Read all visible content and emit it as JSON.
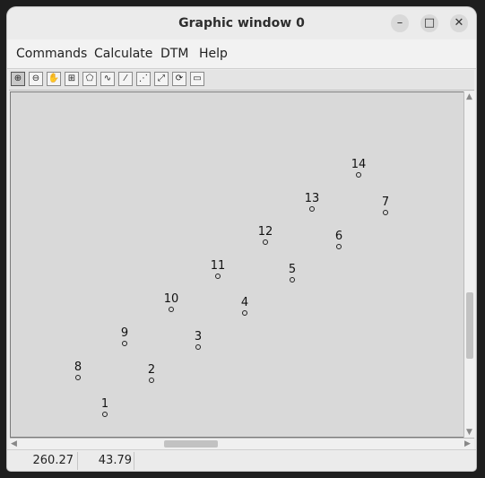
{
  "window": {
    "title": "Graphic window 0",
    "controls": {
      "minimize": "–",
      "maximize": "□",
      "close": "✕"
    }
  },
  "menubar": {
    "items": [
      "Commands",
      "Calculate",
      "DTM",
      "Help"
    ]
  },
  "toolbar": {
    "tools": [
      {
        "name": "zoom-in-tool",
        "glyph": "⊕"
      },
      {
        "name": "zoom-out-tool",
        "glyph": "⊖"
      },
      {
        "name": "pan-hand-tool",
        "glyph": "✋"
      },
      {
        "name": "measure-tool",
        "glyph": "⊞"
      },
      {
        "name": "polygon-tool",
        "glyph": "⬠"
      },
      {
        "name": "contour-tool",
        "glyph": "∿"
      },
      {
        "name": "draw-line-tool",
        "glyph": "⁄"
      },
      {
        "name": "select-point-tool",
        "glyph": "⋰"
      },
      {
        "name": "fit-extents-tool",
        "glyph": "⤢"
      },
      {
        "name": "refresh-tool",
        "glyph": "⟳"
      },
      {
        "name": "select-rect-tool",
        "glyph": "▭"
      }
    ]
  },
  "points": [
    {
      "label": "1"
    },
    {
      "label": "2"
    },
    {
      "label": "3"
    },
    {
      "label": "4"
    },
    {
      "label": "5"
    },
    {
      "label": "6"
    },
    {
      "label": "7"
    },
    {
      "label": "8"
    },
    {
      "label": "9"
    },
    {
      "label": "10"
    },
    {
      "label": "11"
    },
    {
      "label": "12"
    },
    {
      "label": "13"
    },
    {
      "label": "14"
    }
  ],
  "status": {
    "x": "260.27",
    "y": "43.79"
  },
  "scrollbars": {
    "up": "▲",
    "down": "▼",
    "left": "◀",
    "right": "▶"
  }
}
